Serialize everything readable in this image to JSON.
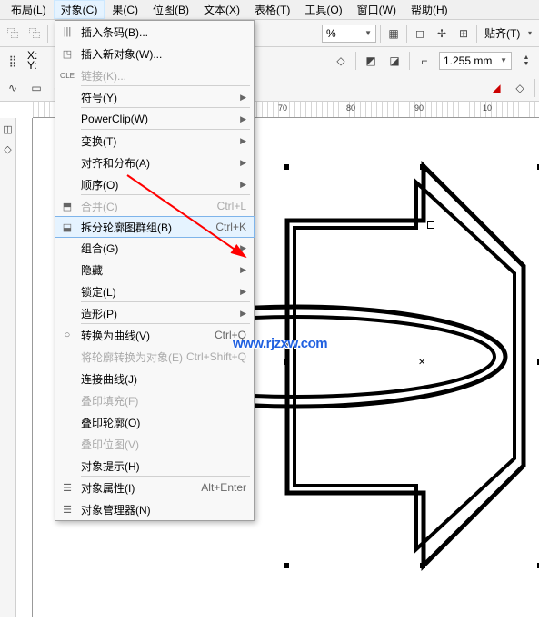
{
  "menubar": {
    "items": [
      {
        "label": "布局(L)",
        "active": false
      },
      {
        "label": "对象(C)",
        "active": true
      },
      {
        "label": "果(C)",
        "active": false
      },
      {
        "label": "位图(B)",
        "active": false
      },
      {
        "label": "文本(X)",
        "active": false
      },
      {
        "label": "表格(T)",
        "active": false
      },
      {
        "label": "工具(O)",
        "active": false
      },
      {
        "label": "窗口(W)",
        "active": false
      },
      {
        "label": "帮助(H)",
        "active": false
      }
    ]
  },
  "toolbar1": {
    "zoom_value": "%",
    "snap_label": "贴齐(T)"
  },
  "toolbar2": {
    "x_label": "X:",
    "y_label": "Y:",
    "outline_width": "1.255 mm"
  },
  "ruler_ticks": [
    "70",
    "80",
    "90",
    "10"
  ],
  "dropdown": {
    "items": [
      {
        "label": "插入条码(B)...",
        "shortcut": "",
        "submenu": false,
        "disabled": false,
        "icon": "|||",
        "sep": false
      },
      {
        "label": "插入新对象(W)...",
        "shortcut": "",
        "submenu": false,
        "disabled": false,
        "icon": "",
        "sep": false
      },
      {
        "label": "链接(K)...",
        "shortcut": "",
        "submenu": false,
        "disabled": true,
        "icon": "OLE",
        "sep": true
      },
      {
        "label": "符号(Y)",
        "shortcut": "",
        "submenu": true,
        "disabled": false,
        "icon": "",
        "sep": true
      },
      {
        "label": "PowerClip(W)",
        "shortcut": "",
        "submenu": true,
        "disabled": false,
        "icon": "",
        "sep": true
      },
      {
        "label": "变换(T)",
        "shortcut": "",
        "submenu": true,
        "disabled": false,
        "icon": "",
        "sep": false
      },
      {
        "label": "对齐和分布(A)",
        "shortcut": "",
        "submenu": true,
        "disabled": false,
        "icon": "",
        "sep": false
      },
      {
        "label": "顺序(O)",
        "shortcut": "",
        "submenu": true,
        "disabled": false,
        "icon": "",
        "sep": true
      },
      {
        "label": "合并(C)",
        "shortcut": "Ctrl+L",
        "submenu": false,
        "disabled": true,
        "icon": "⬒",
        "sep": false
      },
      {
        "label": "拆分轮廓图群组(B)",
        "shortcut": "Ctrl+K",
        "submenu": false,
        "disabled": false,
        "icon": "⬓",
        "sep": false,
        "highlight": true
      },
      {
        "label": "组合(G)",
        "shortcut": "",
        "submenu": true,
        "disabled": false,
        "icon": "",
        "sep": false
      },
      {
        "label": "隐藏",
        "shortcut": "",
        "submenu": true,
        "disabled": false,
        "icon": "",
        "sep": false
      },
      {
        "label": "锁定(L)",
        "shortcut": "",
        "submenu": true,
        "disabled": false,
        "icon": "",
        "sep": true
      },
      {
        "label": "造形(P)",
        "shortcut": "",
        "submenu": true,
        "disabled": false,
        "icon": "",
        "sep": true
      },
      {
        "label": "转换为曲线(V)",
        "shortcut": "Ctrl+Q",
        "submenu": false,
        "disabled": false,
        "icon": "○",
        "sep": false
      },
      {
        "label": "将轮廓转换为对象(E)",
        "shortcut": "Ctrl+Shift+Q",
        "submenu": false,
        "disabled": true,
        "icon": "",
        "sep": false
      },
      {
        "label": "连接曲线(J)",
        "shortcut": "",
        "submenu": false,
        "disabled": false,
        "icon": "",
        "sep": true
      },
      {
        "label": "叠印填充(F)",
        "shortcut": "",
        "submenu": false,
        "disabled": true,
        "icon": "",
        "sep": false
      },
      {
        "label": "叠印轮廓(O)",
        "shortcut": "",
        "submenu": false,
        "disabled": false,
        "icon": "",
        "sep": false
      },
      {
        "label": "叠印位图(V)",
        "shortcut": "",
        "submenu": false,
        "disabled": true,
        "icon": "",
        "sep": false
      },
      {
        "label": "对象提示(H)",
        "shortcut": "",
        "submenu": false,
        "disabled": false,
        "icon": "",
        "sep": true
      },
      {
        "label": "对象属性(I)",
        "shortcut": "Alt+Enter",
        "submenu": false,
        "disabled": false,
        "icon": "☰",
        "sep": false
      },
      {
        "label": "对象管理器(N)",
        "shortcut": "",
        "submenu": false,
        "disabled": false,
        "icon": "☰",
        "sep": false
      }
    ]
  },
  "watermark": "www.rjzxw.com"
}
